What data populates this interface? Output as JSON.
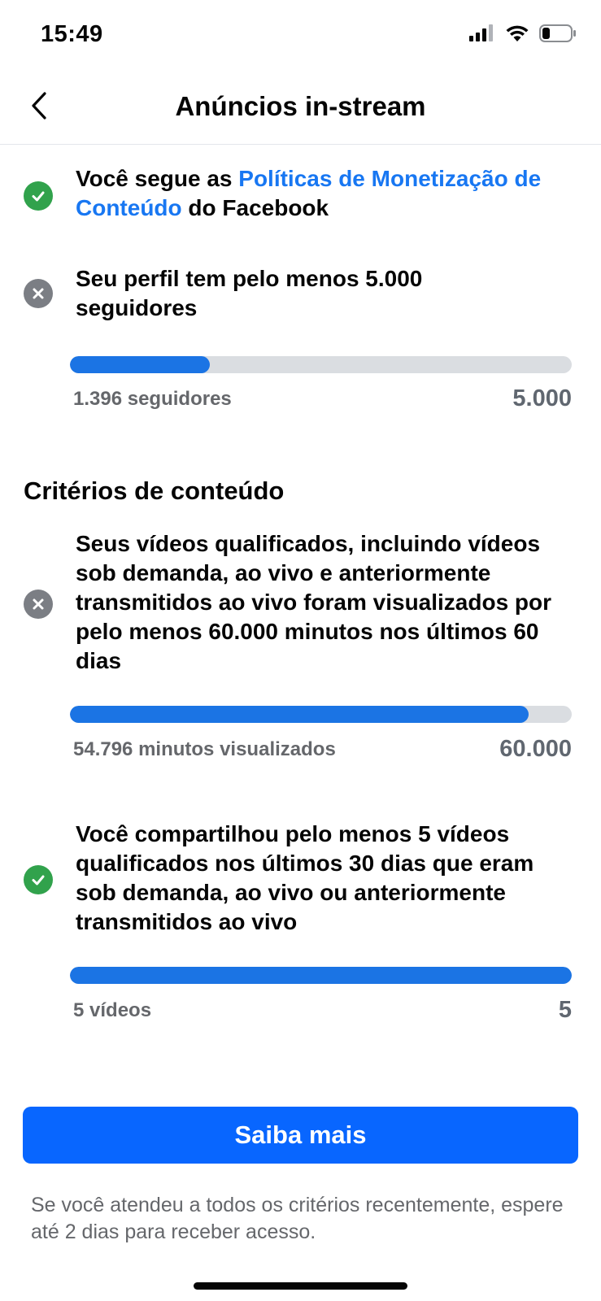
{
  "status_bar": {
    "time": "15:49"
  },
  "header": {
    "title": "Anúncios in-stream"
  },
  "criteria": [
    {
      "status": "met",
      "text_before": "Você segue as ",
      "link_text": "Políticas de Monetização de Conteúdo",
      "text_after": " do Facebook"
    },
    {
      "status": "not-met",
      "text": "Seu perfil tem pelo menos 5.000 seguidores",
      "progress": {
        "current_label": "1.396 seguidores",
        "target_label": "5.000",
        "fraction": 0.2792
      }
    }
  ],
  "content_section": {
    "title": "Critérios de conteúdo",
    "criteria": [
      {
        "status": "not-met",
        "text": "Seus vídeos qualificados, incluindo vídeos sob demanda, ao vivo e anteriormente transmitidos ao vivo foram visualizados por pelo menos 60.000 minutos nos últimos 60 dias",
        "progress": {
          "current_label": "54.796 minutos visualizados",
          "target_label": "60.000",
          "fraction": 0.9133
        }
      },
      {
        "status": "met",
        "text": "Você compartilhou pelo menos 5 vídeos qualificados nos últimos 30 dias que eram sob demanda, ao vivo ou anteriormente transmitidos ao vivo",
        "progress": {
          "current_label": "5 vídeos",
          "target_label": "5",
          "fraction": 1.0
        }
      }
    ]
  },
  "cta": {
    "label": "Saiba mais"
  },
  "footnote": "Se você atendeu a todos os critérios recentemente, espere até 2 dias para receber acesso.",
  "colors": {
    "accent": "#1877f2",
    "button": "#0866ff",
    "met": "#31a24c",
    "not_met": "#7b7e84"
  }
}
